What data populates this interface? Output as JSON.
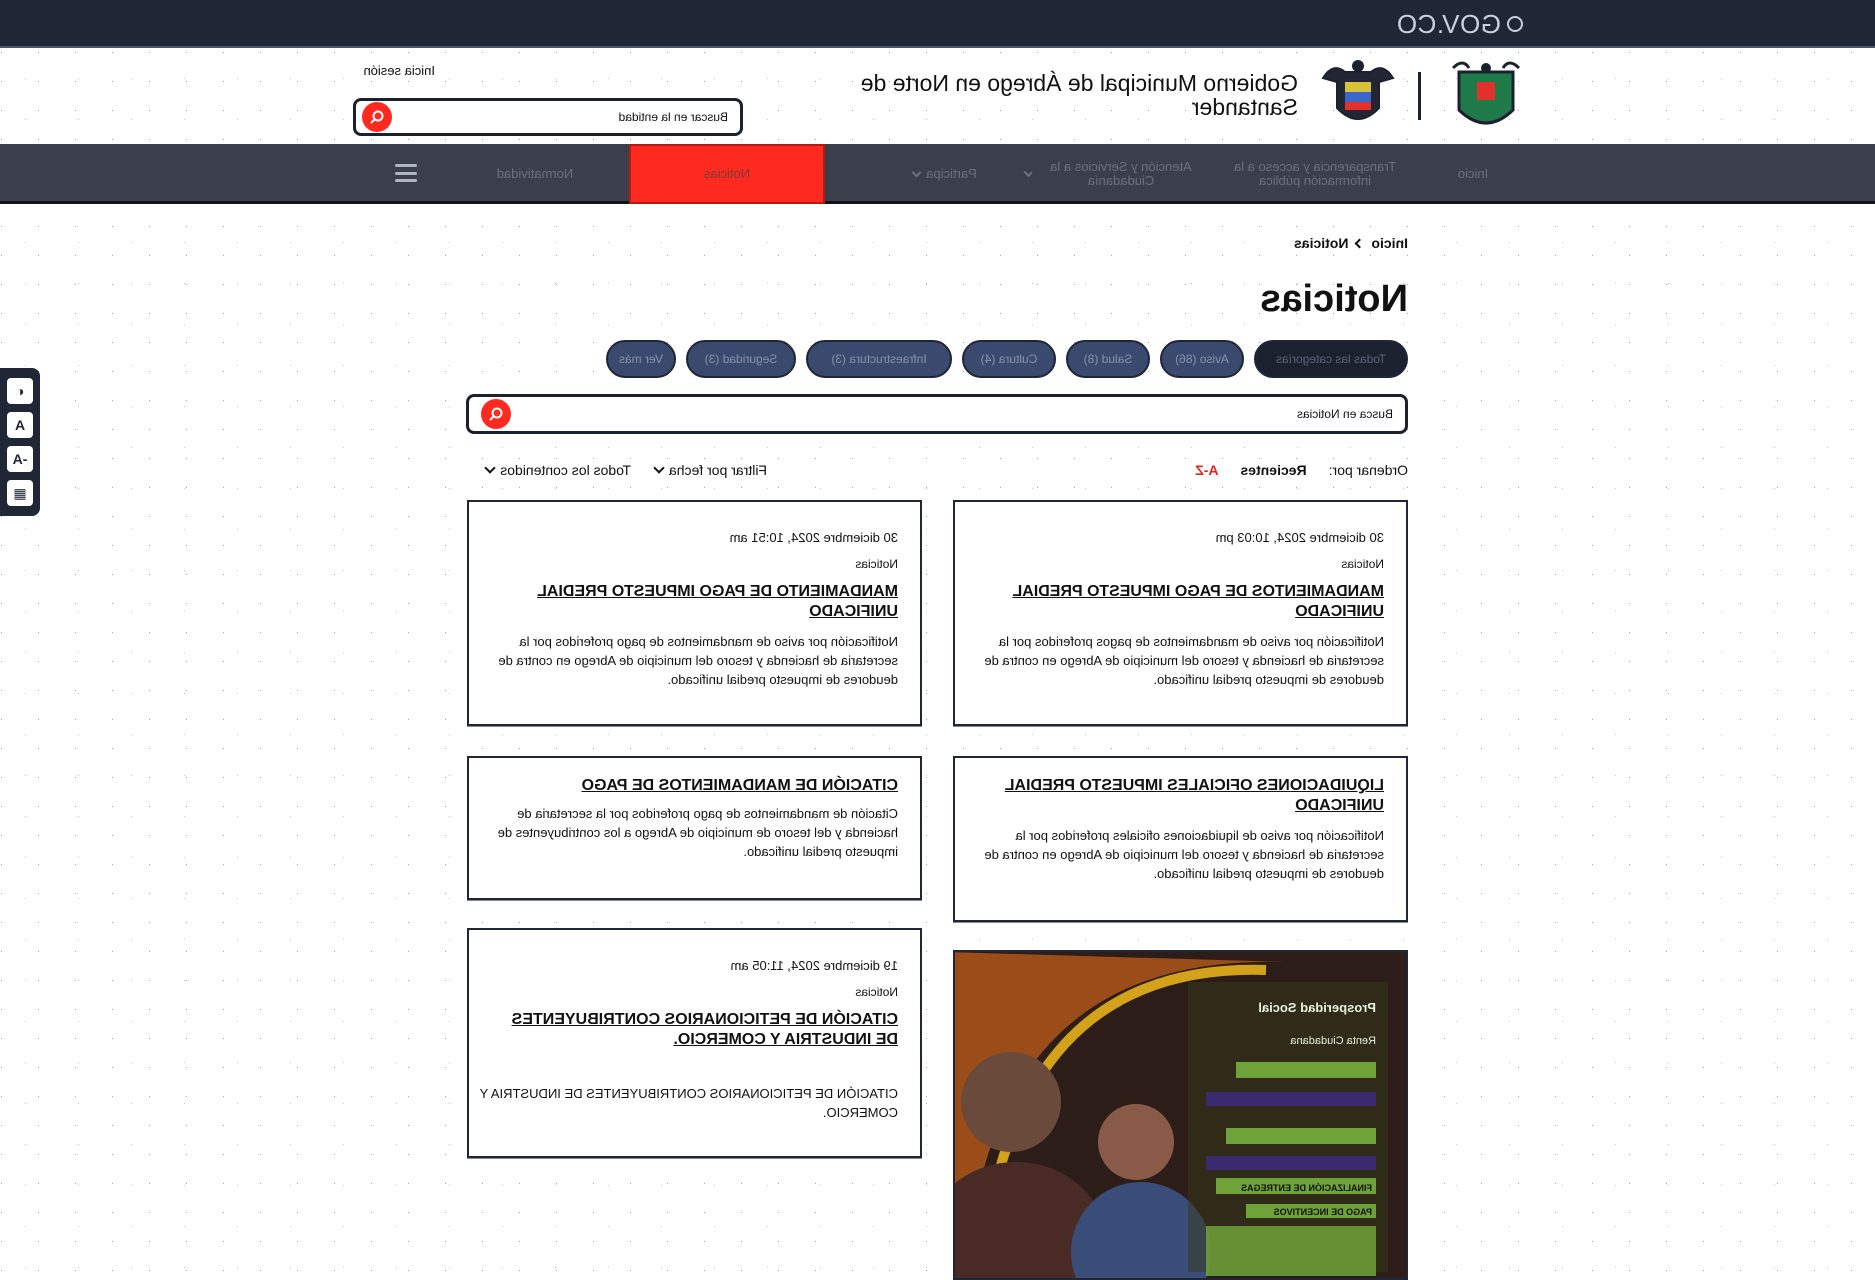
{
  "gov_bar": {
    "logo_text": "GOV.CO"
  },
  "header": {
    "entity_name": "Gobierno Municipal de Ábrego en Norte de Santander",
    "search_placeholder": "Buscar en la entidad",
    "login_label": "Inicia sesión"
  },
  "nav": {
    "items": [
      {
        "label": "Inicio"
      },
      {
        "label": "Transparencia y acceso a la información pública"
      },
      {
        "label": "Atención y Servicios a la Ciudadanía"
      },
      {
        "label": "Participa"
      },
      {
        "label": "Noticias"
      },
      {
        "label": "Normatividad"
      }
    ]
  },
  "accessibility": [
    "◐",
    "A",
    "-A",
    "▦"
  ],
  "breadcrumb": {
    "home": "Inicio",
    "current": "Noticias"
  },
  "page_title": "Noticias",
  "categories": [
    {
      "label": "Todas las categorías",
      "active": true
    },
    {
      "label": "Aviso (86)"
    },
    {
      "label": "Salud (8)"
    },
    {
      "label": "Cultura (4)"
    },
    {
      "label": "Infraestructura (3)"
    },
    {
      "label": "Seguridad (3)"
    },
    {
      "label": "Ver más"
    }
  ],
  "news_search_placeholder": "Busca en Noticias",
  "sort": {
    "label": "Ordenar por:",
    "recent": "Recientes",
    "az": "A-Z"
  },
  "filters": {
    "date": "Filtrar por fecha",
    "content": "Todos los contenidos"
  },
  "cards": [
    {
      "date": "30 diciembre 2024, 10:03 pm",
      "tag": "Noticias",
      "title": "MANDAMIENTOS DE PAGO IMPUESTO PREDIAL UNIFICADO",
      "description": "Notificación por aviso de mandamientos de pagos proferidos por la secretaria de hacienda y tesoro del municipio de Abrego en contra de deudores de impuesto predial unificado."
    },
    {
      "date": "30 diciembre 2024, 10:51 am",
      "tag": "Noticias",
      "title": "MANDAMIENTO DE PAGO IMPUESTO PREDIAL UNIFICADO",
      "description": "Notificación por aviso de mandamientos de pago proferidos por la secretaria de hacienda y tesoro del municipio de Abrego en contra de deudores de impuesto predial unificado."
    },
    {
      "date": "",
      "tag": "",
      "title": "LIQUIDACIONES OFICIALES IMPUESTO PREDIAL UNIFICADO",
      "description": "Notificación por aviso de liquidaciones oficiales proferidos por la secretaria de hacienda y tesoro del municipio de Abrego en contra de deudores de impuesto predial unificado."
    },
    {
      "date": "",
      "tag": "",
      "title": "CITACIÓN DE MANDAMIENTOS DE PAGO",
      "description": "Citación de mandamientos de pago proferidos por la secretaria de hacienda y del tesoro de municipio de Abrego a los contribuyentes de impuesto predial unificado."
    },
    {
      "date": "19 diciembre 2024, 11:05 am",
      "tag": "Noticias",
      "title": "CITACIÓN DE PETICIONARIOS CONTRIBUYENTES DE INDUSTRIA Y COMERCIO.",
      "description": "CITACIÓN DE PETICIONARIOS CONTRIBUYENTES DE INDUSTRIA Y COMERCIO."
    }
  ],
  "image_card": {
    "heading": "Prosperidad Social",
    "subheading": "Renta Ciudadana",
    "lines": [
      "FINALIZACIÓN DE ENTREGAS",
      "PAGO DE INCENTIVOS"
    ]
  },
  "colors": {
    "accent": "#ff2a1f",
    "navbar": "#3a3f4b",
    "govbar": "#1f2636"
  }
}
